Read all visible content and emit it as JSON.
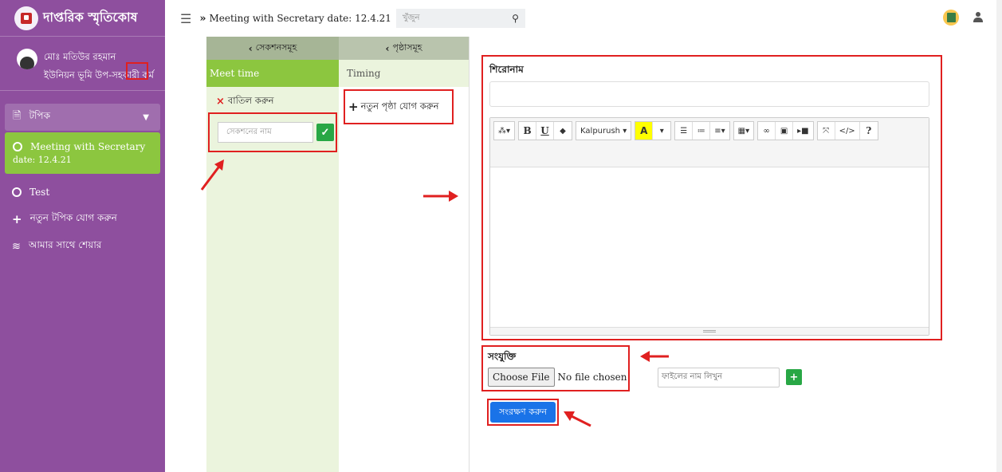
{
  "sidebar": {
    "brand_title": "দাপ্তরিক স্মৃতিকোষ",
    "user_name": "মোঃ মতিউর রহমান",
    "user_designation": "ইউনিয়ন ভূমি উপ-সহকারী কর্ম",
    "nav": {
      "topic_label": "টপিক",
      "active_item_line1": "Meeting with Secretary",
      "active_item_line2": "date: 12.4.21",
      "test_item": "Test",
      "add_topic": "নতুন টপিক যোগ করুন",
      "shared_with_me": "আমার সাথে শেয়ার"
    }
  },
  "topbar": {
    "breadcrumb": "Meeting with Secretary date: 12.4.21",
    "search_placeholder": "খুঁজুন"
  },
  "sections": {
    "header": "সেকশনসমূহ",
    "items": [
      {
        "label": "Meet time"
      }
    ],
    "cancel_label": "বাতিল করুন",
    "new_section_placeholder": "সেকশনের নাম"
  },
  "pages": {
    "header": "পৃষ্ঠাসমূহ",
    "items": [
      {
        "label": "Timing"
      }
    ],
    "add_page_label": "নতুন পৃষ্ঠা যোগ করুন"
  },
  "editor": {
    "title_label": "শিরোনাম",
    "font_name": "Kalpurush",
    "toolbar_buttons": [
      "magic",
      "B",
      "U",
      "eraser",
      "Kalpurush",
      "A",
      "ul",
      "ol",
      "align",
      "table",
      "link",
      "picture",
      "video",
      "fullscreen",
      "code",
      "help"
    ]
  },
  "attachment": {
    "label": "সংযুক্তি",
    "choose_file": "Choose File",
    "no_file": "No file chosen",
    "file_name_placeholder": "ফাইলের নাম লিখুন"
  },
  "save_label": "সংরক্ষণ করুন",
  "colors": {
    "sidebar": "#8e4f9e",
    "active_green": "#8cc63f",
    "highlight_red": "#e02020",
    "save_blue": "#1a73e8"
  }
}
